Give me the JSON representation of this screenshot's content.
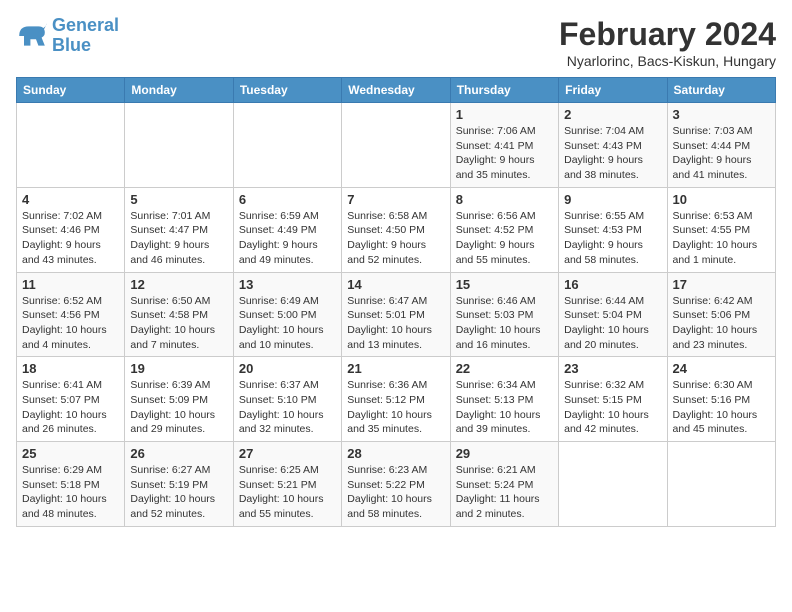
{
  "header": {
    "logo_line1": "General",
    "logo_line2": "Blue",
    "month_title": "February 2024",
    "subtitle": "Nyarlorinc, Bacs-Kiskun, Hungary"
  },
  "weekdays": [
    "Sunday",
    "Monday",
    "Tuesday",
    "Wednesday",
    "Thursday",
    "Friday",
    "Saturday"
  ],
  "weeks": [
    [
      {
        "day": "",
        "info": ""
      },
      {
        "day": "",
        "info": ""
      },
      {
        "day": "",
        "info": ""
      },
      {
        "day": "",
        "info": ""
      },
      {
        "day": "1",
        "info": "Sunrise: 7:06 AM\nSunset: 4:41 PM\nDaylight: 9 hours\nand 35 minutes."
      },
      {
        "day": "2",
        "info": "Sunrise: 7:04 AM\nSunset: 4:43 PM\nDaylight: 9 hours\nand 38 minutes."
      },
      {
        "day": "3",
        "info": "Sunrise: 7:03 AM\nSunset: 4:44 PM\nDaylight: 9 hours\nand 41 minutes."
      }
    ],
    [
      {
        "day": "4",
        "info": "Sunrise: 7:02 AM\nSunset: 4:46 PM\nDaylight: 9 hours\nand 43 minutes."
      },
      {
        "day": "5",
        "info": "Sunrise: 7:01 AM\nSunset: 4:47 PM\nDaylight: 9 hours\nand 46 minutes."
      },
      {
        "day": "6",
        "info": "Sunrise: 6:59 AM\nSunset: 4:49 PM\nDaylight: 9 hours\nand 49 minutes."
      },
      {
        "day": "7",
        "info": "Sunrise: 6:58 AM\nSunset: 4:50 PM\nDaylight: 9 hours\nand 52 minutes."
      },
      {
        "day": "8",
        "info": "Sunrise: 6:56 AM\nSunset: 4:52 PM\nDaylight: 9 hours\nand 55 minutes."
      },
      {
        "day": "9",
        "info": "Sunrise: 6:55 AM\nSunset: 4:53 PM\nDaylight: 9 hours\nand 58 minutes."
      },
      {
        "day": "10",
        "info": "Sunrise: 6:53 AM\nSunset: 4:55 PM\nDaylight: 10 hours\nand 1 minute."
      }
    ],
    [
      {
        "day": "11",
        "info": "Sunrise: 6:52 AM\nSunset: 4:56 PM\nDaylight: 10 hours\nand 4 minutes."
      },
      {
        "day": "12",
        "info": "Sunrise: 6:50 AM\nSunset: 4:58 PM\nDaylight: 10 hours\nand 7 minutes."
      },
      {
        "day": "13",
        "info": "Sunrise: 6:49 AM\nSunset: 5:00 PM\nDaylight: 10 hours\nand 10 minutes."
      },
      {
        "day": "14",
        "info": "Sunrise: 6:47 AM\nSunset: 5:01 PM\nDaylight: 10 hours\nand 13 minutes."
      },
      {
        "day": "15",
        "info": "Sunrise: 6:46 AM\nSunset: 5:03 PM\nDaylight: 10 hours\nand 16 minutes."
      },
      {
        "day": "16",
        "info": "Sunrise: 6:44 AM\nSunset: 5:04 PM\nDaylight: 10 hours\nand 20 minutes."
      },
      {
        "day": "17",
        "info": "Sunrise: 6:42 AM\nSunset: 5:06 PM\nDaylight: 10 hours\nand 23 minutes."
      }
    ],
    [
      {
        "day": "18",
        "info": "Sunrise: 6:41 AM\nSunset: 5:07 PM\nDaylight: 10 hours\nand 26 minutes."
      },
      {
        "day": "19",
        "info": "Sunrise: 6:39 AM\nSunset: 5:09 PM\nDaylight: 10 hours\nand 29 minutes."
      },
      {
        "day": "20",
        "info": "Sunrise: 6:37 AM\nSunset: 5:10 PM\nDaylight: 10 hours\nand 32 minutes."
      },
      {
        "day": "21",
        "info": "Sunrise: 6:36 AM\nSunset: 5:12 PM\nDaylight: 10 hours\nand 35 minutes."
      },
      {
        "day": "22",
        "info": "Sunrise: 6:34 AM\nSunset: 5:13 PM\nDaylight: 10 hours\nand 39 minutes."
      },
      {
        "day": "23",
        "info": "Sunrise: 6:32 AM\nSunset: 5:15 PM\nDaylight: 10 hours\nand 42 minutes."
      },
      {
        "day": "24",
        "info": "Sunrise: 6:30 AM\nSunset: 5:16 PM\nDaylight: 10 hours\nand 45 minutes."
      }
    ],
    [
      {
        "day": "25",
        "info": "Sunrise: 6:29 AM\nSunset: 5:18 PM\nDaylight: 10 hours\nand 48 minutes."
      },
      {
        "day": "26",
        "info": "Sunrise: 6:27 AM\nSunset: 5:19 PM\nDaylight: 10 hours\nand 52 minutes."
      },
      {
        "day": "27",
        "info": "Sunrise: 6:25 AM\nSunset: 5:21 PM\nDaylight: 10 hours\nand 55 minutes."
      },
      {
        "day": "28",
        "info": "Sunrise: 6:23 AM\nSunset: 5:22 PM\nDaylight: 10 hours\nand 58 minutes."
      },
      {
        "day": "29",
        "info": "Sunrise: 6:21 AM\nSunset: 5:24 PM\nDaylight: 11 hours\nand 2 minutes."
      },
      {
        "day": "",
        "info": ""
      },
      {
        "day": "",
        "info": ""
      }
    ]
  ]
}
